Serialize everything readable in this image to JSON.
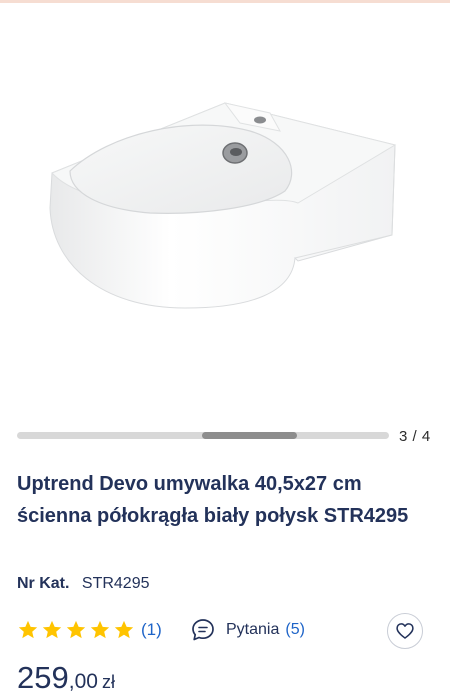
{
  "gallery": {
    "image_alt": "white semicircular wall-mounted washbasin",
    "counter": "3 / 4",
    "current": 3,
    "total": 4
  },
  "product": {
    "title": "Uptrend Devo umywalka 40,5x27 cm ścienna półokrągła biały połysk STR4295",
    "catalog_label": "Nr Kat.",
    "catalog_value": "STR4295"
  },
  "rating": {
    "stars": 5,
    "reviews": "(1)",
    "star_color": "#ffc400"
  },
  "questions": {
    "label": "Pytania",
    "count": "(5)",
    "icon": "chat-bubble-icon"
  },
  "favorite": {
    "icon": "heart-icon"
  },
  "price": {
    "integer": "259",
    "decimal": ",00",
    "currency": "zł"
  },
  "colors": {
    "text": "#23325a",
    "link": "#1e64c8",
    "scroll_track": "#d8d8d8",
    "scroll_thumb": "#8d8d8d"
  }
}
